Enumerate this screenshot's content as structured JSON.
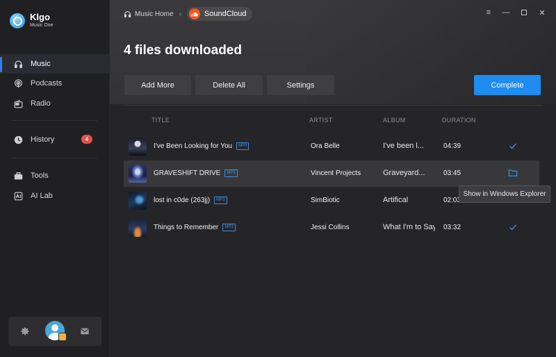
{
  "app": {
    "name": "Klgo",
    "subtitle": "Music One"
  },
  "sidebar": {
    "items": [
      {
        "label": "Music",
        "icon": "headphones-icon",
        "active": true
      },
      {
        "label": "Podcasts",
        "icon": "podcast-icon"
      },
      {
        "label": "Radio",
        "icon": "radio-icon"
      },
      {
        "label": "History",
        "icon": "clock-icon",
        "badge": "4"
      },
      {
        "label": "Tools",
        "icon": "toolbox-icon"
      },
      {
        "label": "AI Lab",
        "icon": "ai-icon"
      }
    ],
    "bottom": {
      "settings_icon": "gear-icon",
      "avatar": "user-avatar",
      "mail_icon": "mail-icon"
    }
  },
  "breadcrumb": {
    "home": "Music Home",
    "source": "SoundCloud"
  },
  "page": {
    "title": "4 files downloaded"
  },
  "toolbar": {
    "add_more": "Add More",
    "delete_all": "Delete All",
    "settings": "Settings",
    "complete": "Complete"
  },
  "table": {
    "headers": {
      "title": "TITLE",
      "artist": "ARTIST",
      "album": "ALBUM",
      "duration": "DURATION"
    },
    "rows": [
      {
        "title": "I've Been Looking for You",
        "format": "MP3",
        "artist": "Ora Belle",
        "album": "I've been l...",
        "duration": "04:39",
        "status": "check-icon"
      },
      {
        "title": "GRAVESHIFT DRIVE",
        "format": "MP3",
        "artist": "Vincent Projects",
        "album": "Graveyard...",
        "duration": "03:45",
        "status": "folder-icon"
      },
      {
        "title": "lost in c0de (263jj)",
        "format": "MP3",
        "artist": "SimBiotic",
        "album": "Artifical",
        "duration": "02:03",
        "status": ""
      },
      {
        "title": "Things to Remember",
        "format": "MP3",
        "artist": "Jessi Collins",
        "album": "What I'm to Say",
        "duration": "03:32",
        "status": "check-icon"
      }
    ]
  },
  "tooltip": "Show in Windows Explorer",
  "colors": {
    "accent": "#1f8cf0",
    "badge": "#e3524d",
    "soundcloud": "#f25822"
  }
}
